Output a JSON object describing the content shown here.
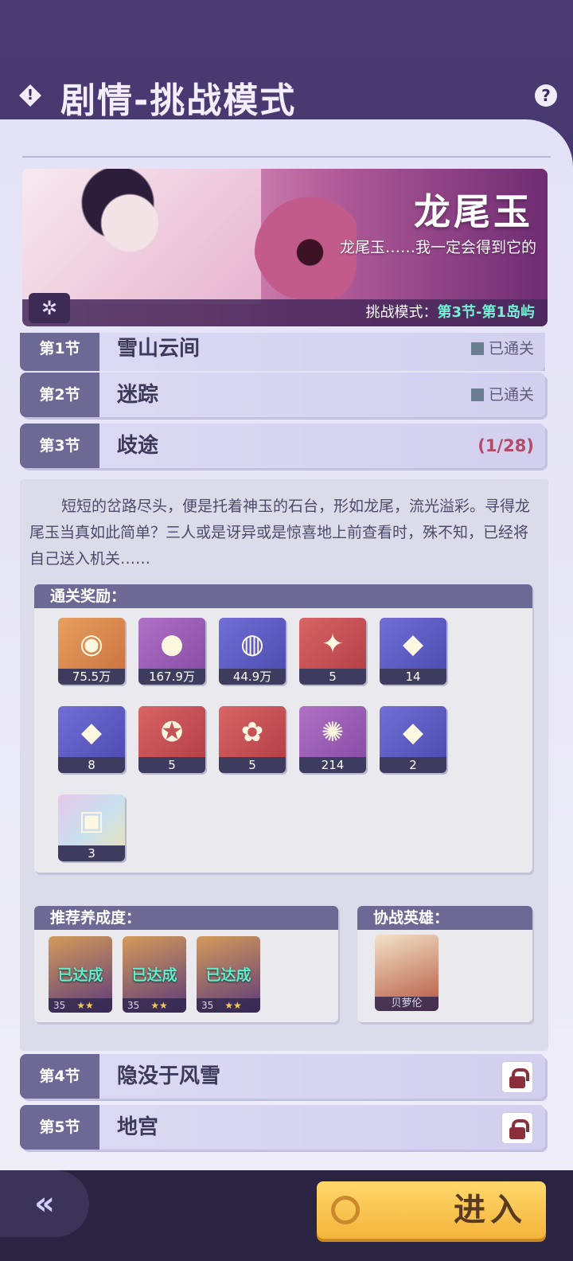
{
  "header": {
    "title": "剧情-挑战模式",
    "warn_glyph": "!",
    "help_glyph": "?"
  },
  "banner": {
    "name": "龙尾玉",
    "quote": "龙尾玉……我一定会得到它的",
    "mode_label": "挑战模式：",
    "mode_value": "第3节-第1岛屿",
    "emblem_glyph": "✲"
  },
  "chapters": [
    {
      "num": "第1节",
      "name": "雪山云间",
      "status": "已通关"
    },
    {
      "num": "第2节",
      "name": "迷踪",
      "status": "已通关"
    },
    {
      "num": "第3节",
      "name": "歧途",
      "progress": "(1/28)"
    },
    {
      "num": "第4节",
      "name": "隐没于风雪"
    },
    {
      "num": "第5节",
      "name": "地宫"
    }
  ],
  "detail": {
    "description": "短短的岔路尽头，便是托着神玉的石台，形如龙尾，流光溢彩。寻得龙尾玉当真如此简单？三人或是讶异或是惊喜地上前查看时，殊不知，已经将自己送入机关……",
    "rewards_title": "通关奖励：",
    "rewards": [
      {
        "count": "75.5万",
        "icon": "gold-coin-icon",
        "glyph": "◉"
      },
      {
        "count": "167.9万",
        "icon": "pink-orb-icon",
        "glyph": "●"
      },
      {
        "count": "44.9万",
        "icon": "blue-orb-icon",
        "glyph": "◍"
      },
      {
        "count": "5",
        "icon": "puzzle-fragment-icon",
        "glyph": "✦"
      },
      {
        "count": "14",
        "icon": "blue-gem-icon",
        "glyph": "◆"
      },
      {
        "count": "8",
        "icon": "double-gem-icon",
        "glyph": "◆"
      },
      {
        "count": "5",
        "icon": "hero-fragment-icon",
        "glyph": "✪"
      },
      {
        "count": "5",
        "icon": "hero-portrait-fragment-icon",
        "glyph": "✿"
      },
      {
        "count": "214",
        "icon": "cloud-orb-icon",
        "glyph": "✺"
      },
      {
        "count": "2",
        "icon": "triple-gem-icon",
        "glyph": "◆"
      },
      {
        "count": "3",
        "icon": "card-icon",
        "glyph": "▣"
      }
    ],
    "recommend_title": "推荐养成度：",
    "recommend_heroes": [
      {
        "status": "已达成",
        "level": "35",
        "stars": "★★"
      },
      {
        "status": "已达成",
        "level": "35",
        "stars": "★★"
      },
      {
        "status": "已达成",
        "level": "35",
        "stars": "★★"
      }
    ],
    "assist_title": "协战英雄：",
    "assist_hero": {
      "name": "贝萝伦"
    }
  },
  "footer": {
    "back_glyph": "«",
    "enter_label": "进入"
  }
}
